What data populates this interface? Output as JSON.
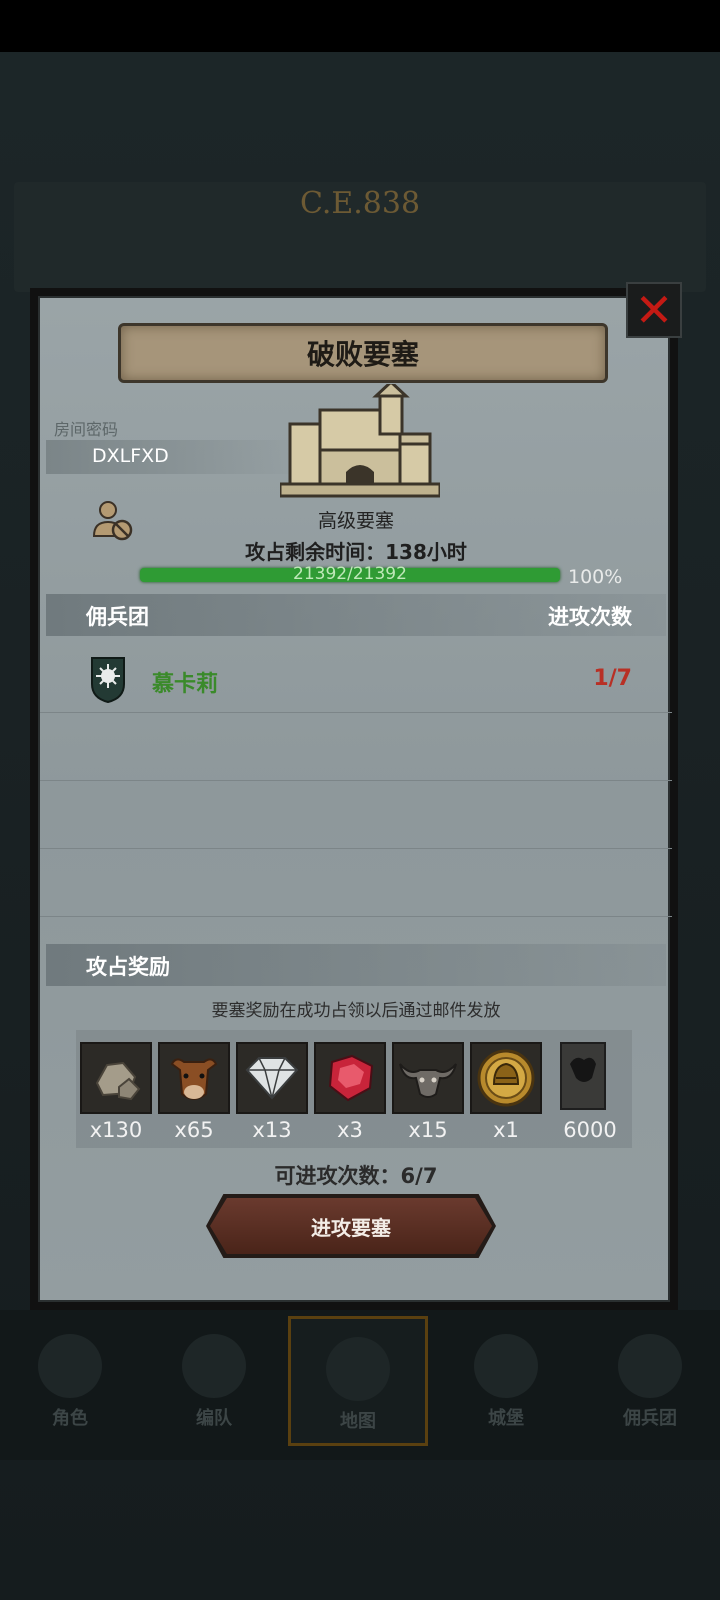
{
  "background": {
    "era": "C.E.838",
    "nav": [
      "角色",
      "编队",
      "地图",
      "城堡",
      "佣兵团"
    ]
  },
  "dialog": {
    "title": "破败要塞",
    "room_label": "房间密码",
    "room_code": "DXLFXD",
    "fortress_name": "高级要塞",
    "time_label": "攻占剩余时间：138小时",
    "hp_text": "21392/21392",
    "hp_percent": "100%",
    "hp_fraction": 1.0,
    "guild_section": {
      "left": "佣兵团",
      "right": "进攻次数"
    },
    "guilds": [
      {
        "name": "慕卡莉",
        "attacks": "1/7"
      }
    ],
    "reward_section": "攻占奖励",
    "reward_note": "要塞奖励在成功占领以后通过邮件发放",
    "rewards": [
      {
        "icon": "stone-icon",
        "qty": "x130"
      },
      {
        "icon": "ox-icon",
        "qty": "x65"
      },
      {
        "icon": "diamond-icon",
        "qty": "x13"
      },
      {
        "icon": "ruby-icon",
        "qty": "x3"
      },
      {
        "icon": "bull-skull-icon",
        "qty": "x15"
      },
      {
        "icon": "helmet-coin-icon",
        "qty": "x1"
      },
      {
        "icon": "banner-icon",
        "qty": "6000"
      }
    ],
    "attack_count": "可进攻次数：6/7",
    "attack_button": "进攻要塞"
  },
  "colors": {
    "accent_red": "#c41a14",
    "guild_green": "#3a8a2a",
    "hp_green": "#2f9b34"
  }
}
